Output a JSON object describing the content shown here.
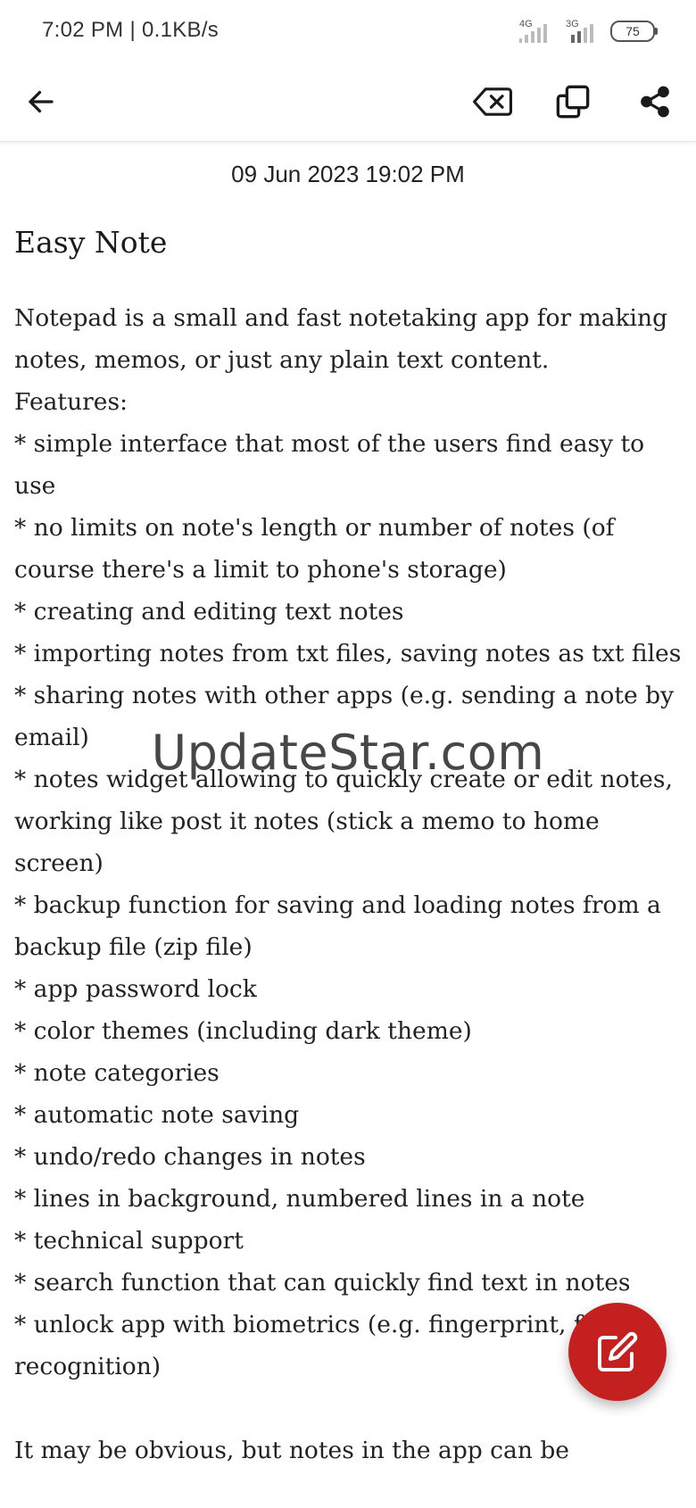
{
  "status_bar": {
    "time": "7:02 PM | 0.1KB/s",
    "signal1_label": "4G",
    "signal2_label": "3G",
    "battery": "75"
  },
  "toolbar": {
    "back_icon": "arrow-left-icon",
    "clear_icon": "backspace-icon",
    "copy_icon": "copy-icon",
    "share_icon": "share-icon"
  },
  "note": {
    "date": "09 Jun 2023  19:02 PM",
    "title": "Easy Note",
    "body": "Notepad is a small and fast notetaking app for making notes, memos, or just any plain text content.\nFeatures:\n* simple interface that most of the users find easy to use\n* no limits on note's length or number of notes (of course there's a limit to phone's storage)\n* creating and editing text notes\n* importing notes from txt files, saving notes as txt files\n* sharing notes with other apps (e.g. sending a note by email)\n* notes widget allowing to quickly create or edit notes, working like post it notes (stick a memo to home screen)\n* backup function for saving and loading notes from a backup file (zip file)\n* app password lock\n* color themes (including dark theme)\n* note categories\n* automatic note saving\n* undo/redo changes in notes\n* lines in background, numbered lines in a note\n* technical support\n* search function that can quickly find text in notes\n* unlock app with biometrics (e.g. fingerprint, face recognition)\n\nIt may be obvious, but notes in the app can be"
  },
  "watermark": "UpdateStar.com",
  "fab": {
    "icon": "edit-icon",
    "color": "#c4201f"
  }
}
